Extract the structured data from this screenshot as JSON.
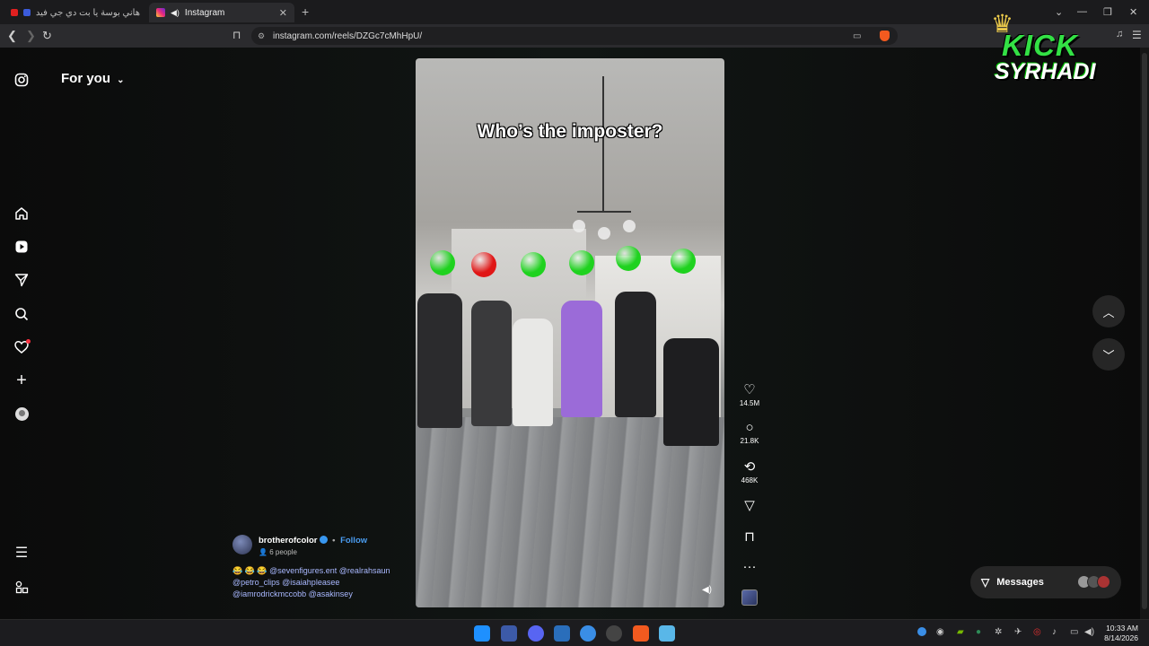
{
  "browser": {
    "tabs": [
      {
        "title": "هاني بوسة يا بت دي جي فيديو اوزك",
        "active": false
      },
      {
        "title": "Instagram",
        "active": true
      }
    ],
    "new_tab": "+",
    "url": "instagram.com/reels/DZGc7cMhHpU/"
  },
  "sidebar": {
    "items": [
      {
        "name": "instagram-icon"
      },
      {
        "name": "home-icon"
      },
      {
        "name": "reels-icon"
      },
      {
        "name": "send-icon"
      },
      {
        "name": "search-icon"
      },
      {
        "name": "heart-icon"
      },
      {
        "name": "create-icon"
      },
      {
        "name": "profile-icon"
      },
      {
        "name": "menu-icon"
      },
      {
        "name": "more-icon"
      }
    ]
  },
  "feed": {
    "title": "For you"
  },
  "reel": {
    "overlay_text": "Who’s the imposter?",
    "dot_colors": [
      "#1fd21f",
      "#e01616",
      "#1fd21f",
      "#1fd21f",
      "#1fd21f",
      "#1fd21f"
    ]
  },
  "actions": {
    "likes": "14.5M",
    "comments": "21.8K",
    "reposts": "468K"
  },
  "post": {
    "username": "brotherofcolor",
    "separator": "•",
    "follow": "Follow",
    "people": "6 people",
    "caption_line1": "😂 😂 😂 @sevenfigures.ent @realrahsaun",
    "caption_line2": "@petro_clips @isaiahpleasee",
    "caption_line3": "@iamrodrickmccobb @asakinsey"
  },
  "messages": {
    "label": "Messages"
  },
  "overlay_logo": {
    "line1": "KICK",
    "line2": "SYRHADI"
  },
  "taskbar": {
    "time": "10:33 AM",
    "date": "8/14/2026"
  },
  "colors": {
    "accent": "#4a9cf0",
    "notification": "#ff3040"
  }
}
